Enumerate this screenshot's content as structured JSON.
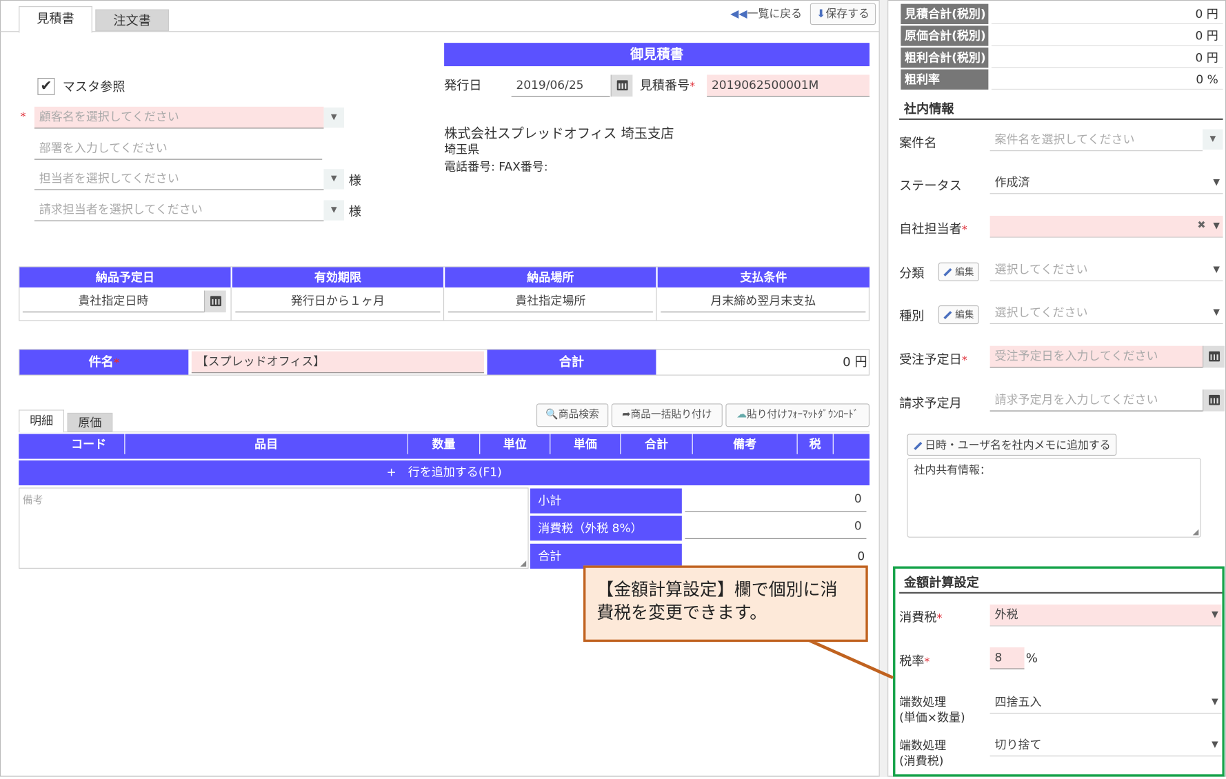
{
  "tabs": {
    "quote": "見積書",
    "order": "注文書"
  },
  "toolbar": {
    "back": "一覧に戻る",
    "save": "保存する"
  },
  "customer": {
    "master_ref": "マスタ参照",
    "customer_placeholder": "顧客名を選択してください",
    "dept_placeholder": "部署を入力してください",
    "contact_placeholder": "担当者を選択してください",
    "billing_placeholder": "請求担当者を選択してください",
    "honorific": "様",
    "req": "*"
  },
  "quote": {
    "heading": "御見積書",
    "issue_label": "発行日",
    "issue_date": "2019/06/25",
    "number_label": "見積番号",
    "number": "2019062500001M",
    "company": "株式会社スプレッドオフィス 埼玉支店",
    "pref": "埼玉県",
    "phone_fax": "電話番号:  FAX番号:"
  },
  "terms": {
    "headers": [
      "納品予定日",
      "有効期限",
      "納品場所",
      "支払条件"
    ],
    "values": [
      "貴社指定日時",
      "発行日から１ヶ月",
      "貴社指定場所",
      "月末締め翌月末支払"
    ]
  },
  "subject": {
    "label": "件名",
    "value": "【スプレッドオフィス】",
    "total_label": "合計",
    "total_value": "0 円"
  },
  "detail_tabs": {
    "detail": "明細",
    "cost": "原価"
  },
  "detail_buttons": {
    "search": "商品検索",
    "paste": "商品一括貼り付け",
    "download": "貼り付けﾌｫｰﾏｯﾄﾀﾞｳﾝﾛｰﾄﾞ"
  },
  "table": {
    "columns": [
      "",
      "コード",
      "品目",
      "数量",
      "単位",
      "単価",
      "合計",
      "備考",
      "税",
      ""
    ],
    "add_row": "+　行を追加する(F1)"
  },
  "notes_label": "備考",
  "totals": [
    {
      "label": "小計",
      "value": "0"
    },
    {
      "label": "消費税（外税 8%）",
      "value": "0"
    },
    {
      "label": "合計",
      "value": "0"
    }
  ],
  "summary": [
    {
      "label": "見積合計(税別)",
      "value": "0 円"
    },
    {
      "label": "原価合計(税別)",
      "value": "0 円"
    },
    {
      "label": "粗利合計(税別)",
      "value": "0 円"
    },
    {
      "label": "粗利率",
      "value": "0 %"
    }
  ],
  "internal": {
    "heading": "社内情報",
    "project_label": "案件名",
    "project_placeholder": "案件名を選択してください",
    "status_label": "ステータス",
    "status_value": "作成済",
    "owner_label": "自社担当者",
    "category_label": "分類",
    "type_label": "種別",
    "edit": "編集",
    "select_placeholder": "選択してください",
    "order_date_label": "受注予定日",
    "order_date_placeholder": "受注予定日を入力してください",
    "billing_month_label": "請求予定月",
    "billing_month_placeholder": "請求予定月を入力してください",
    "memo_button": "日時・ユーザ名を社内メモに追加する",
    "memo_text": "社内共有情報："
  },
  "calc": {
    "heading": "金額計算設定",
    "tax_label": "消費税",
    "tax_value": "外税",
    "rate_label": "税率",
    "rate_value": "8",
    "rate_unit": "%",
    "round1_label1": "端数処理",
    "round1_label2": "(単価×数量)",
    "round1_value": "四捨五入",
    "round2_label1": "端数処理",
    "round2_label2": "(消費税)",
    "round2_value": "切り捨て"
  },
  "callout": {
    "line1": "【金額計算設定】欄で個別に消",
    "line2": "費税を変更できます。"
  },
  "colors": {
    "header": "#5b52ff",
    "required_bg": "#fde3e3",
    "highlight": "#16a34a",
    "callout_border": "#c0621f",
    "callout_bg": "#fde9d9"
  }
}
